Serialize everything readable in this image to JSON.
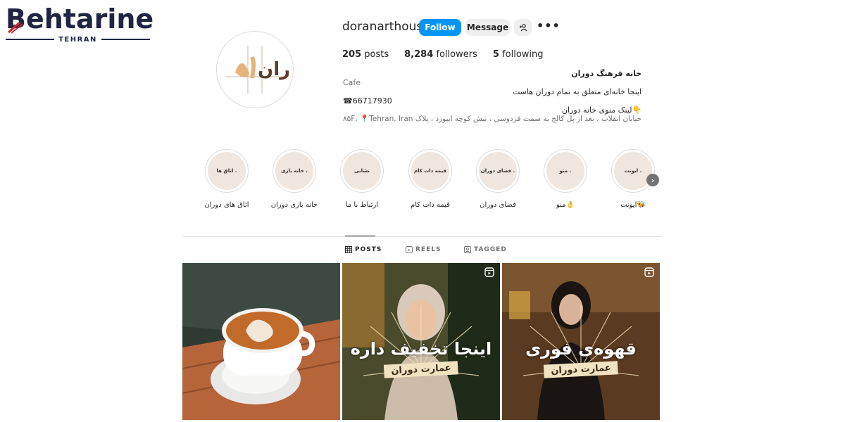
{
  "watermark": {
    "brand": "Behtarine",
    "sub": "TEHRAN"
  },
  "avatar": {
    "logo_text": "دوران"
  },
  "header": {
    "username": "doranarthouse",
    "follow_label": "Follow",
    "message_label": "Message",
    "more_label": "•••"
  },
  "stats": {
    "posts_count": "205",
    "posts_label": "posts",
    "followers_count": "8,284",
    "followers_label": "followers",
    "following_count": "5",
    "following_label": "following"
  },
  "bio": {
    "name": "خانه فرهنگ دوران",
    "category": "Cafe",
    "line1": "اینجا خانه‌ای متعلق به تمام دوران هاست",
    "phone": "☎66717930",
    "menu_link": "👇لینک منوی خانه دوران",
    "address": "خیابان انقلاب ، بعد از پل کالج به سمت فردوسی ، نبش کوچه ابیورد ، پلاک ۸۵F، 📍Tehran, Iran"
  },
  "highlights": [
    {
      "cover": "اتاق ها .",
      "label": "اتاق های دوران"
    },
    {
      "cover": "خانه بازی .",
      "label": "خانه بازی دوران"
    },
    {
      "cover": "نشانی",
      "label": "ارتباط با ما"
    },
    {
      "cover": "قیمه دات کام",
      "label": "قیمه دات کام"
    },
    {
      "cover": "فضای دوران .",
      "label": "فضای دوران"
    },
    {
      "cover": "منو .",
      "label": "منو👌"
    },
    {
      "cover": "ایونت .",
      "label": "ایونت🐝"
    }
  ],
  "highlights_next": "›",
  "tabs": {
    "posts": "POSTS",
    "reels": "REELS",
    "tagged": "TAGGED"
  },
  "posts": [
    {
      "caption": "",
      "tag": ""
    },
    {
      "caption": "اینجا تخفیف داره",
      "tag": "عمارت دوران"
    },
    {
      "caption": "قهوه‌ی فوری",
      "tag": "عمارت دوران"
    }
  ],
  "colors": {
    "follow_blue": "#0095f6",
    "brand_navy": "#1f2542",
    "brand_red": "#d6252f"
  }
}
